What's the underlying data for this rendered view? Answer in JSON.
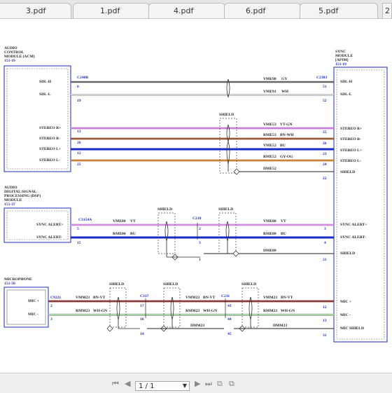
{
  "tabs": [
    {
      "label": "3.pdf"
    },
    {
      "label": "1.pdf"
    },
    {
      "label": "4.pdf"
    },
    {
      "label": "6.pdf"
    },
    {
      "label": "5.pdf"
    },
    {
      "label": "2"
    }
  ],
  "diagram": {
    "modules": {
      "acm": {
        "lines": [
          "AUDIO",
          "CONTROL",
          "MODULE (ACM)"
        ],
        "ref": "151-19"
      },
      "dsp": {
        "lines": [
          "AUDIO",
          "DIGITAL SIGNAL",
          "PROCESSING (DSP)",
          "MODULE"
        ],
        "ref": "151-37"
      },
      "mic": {
        "lines": [
          "MICROPHONE"
        ],
        "ref": "151-50"
      },
      "apim": {
        "lines": [
          "SYNC",
          "MODULE",
          "[APIM]"
        ],
        "ref": "151-19"
      }
    },
    "connectors": {
      "c240b": "C240B",
      "c2383": "C2383",
      "c3154a": "C3154A",
      "c210": "C210",
      "c9221": "C9221",
      "c317": "C317",
      "c211": "C211"
    },
    "acm_pins": [
      {
        "label": "SDL-H",
        "pin": "6"
      },
      {
        "label": "SDL-L",
        "pin": "19"
      },
      {
        "label": "STEREO R+",
        "pin": "13"
      },
      {
        "label": "STEREO R-",
        "pin": "26"
      },
      {
        "label": "STEREO L+",
        "pin": "12"
      },
      {
        "label": "STEREO L-",
        "pin": "25"
      }
    ],
    "dsp_pins": [
      {
        "label": "SYNC ALERT+",
        "pin": "5"
      },
      {
        "label": "SYNC ALERT-",
        "pin": "15"
      }
    ],
    "mic_pins": [
      {
        "label": "MIC +",
        "pin": "2"
      },
      {
        "label": "MIC -",
        "pin": "3"
      }
    ],
    "apim_pins": [
      {
        "label": "SDL-H",
        "pin": "51"
      },
      {
        "label": "SDL-L",
        "pin": "52"
      },
      {
        "label": "STEREO R+",
        "pin": "25"
      },
      {
        "label": "STEREO R-",
        "pin": "26"
      },
      {
        "label": "STEREO L+",
        "pin": "23"
      },
      {
        "label": "STEREO L-",
        "pin": "24"
      },
      {
        "label": "SHIELD",
        "pin": "22"
      },
      {
        "label": "SYNC ALERT+",
        "pin": "3"
      },
      {
        "label": "SYNC ALERT-",
        "pin": "4"
      },
      {
        "label": "SHIELD",
        "pin": "21"
      },
      {
        "label": "MIC +",
        "pin": "12"
      },
      {
        "label": "MIC -",
        "pin": "13"
      },
      {
        "label": "MIC SHIELD",
        "pin": "31"
      }
    ],
    "circuits": [
      {
        "code": "VME90",
        "color_code": "GY",
        "color": "#8d8d8d"
      },
      {
        "code": "VME91",
        "color_code": "WH",
        "color": "#d4d4d4"
      },
      {
        "code": "VME53",
        "color_code": "VT-GN",
        "color": "#c87fd6"
      },
      {
        "code": "RME53",
        "color_code": "BN-WH",
        "color": "#9b5a3a"
      },
      {
        "code": "VME52",
        "color_code": "BU",
        "color": "#1b2cc6"
      },
      {
        "code": "RME52",
        "color_code": "GY-OG",
        "color": "#c8843a"
      },
      {
        "code": "DME52",
        "color_code": "",
        "color": "#222222"
      },
      {
        "code": "VME80",
        "color_code": "VT",
        "color": "#d38de0"
      },
      {
        "code": "RME80",
        "color_code": "BU",
        "color": "#1b2cc6"
      },
      {
        "code": "DME80",
        "color_code": "",
        "color": "#222222"
      },
      {
        "code": "VMM23",
        "color_code": "BN-VT",
        "color": "#8b3a3a"
      },
      {
        "code": "RMM23",
        "color_code": "WH-GN",
        "color": "#a8d3a8"
      },
      {
        "code": "DMM23",
        "color_code": "",
        "color": "#222222"
      }
    ],
    "splice_pins": {
      "c210": [
        "2",
        "3",
        "1"
      ],
      "c317": [
        "17",
        "18",
        "14"
      ],
      "c211": [
        "43",
        "44",
        "45"
      ]
    },
    "shield_label": "SHIELD"
  },
  "pager": {
    "current": "1 / 1"
  }
}
